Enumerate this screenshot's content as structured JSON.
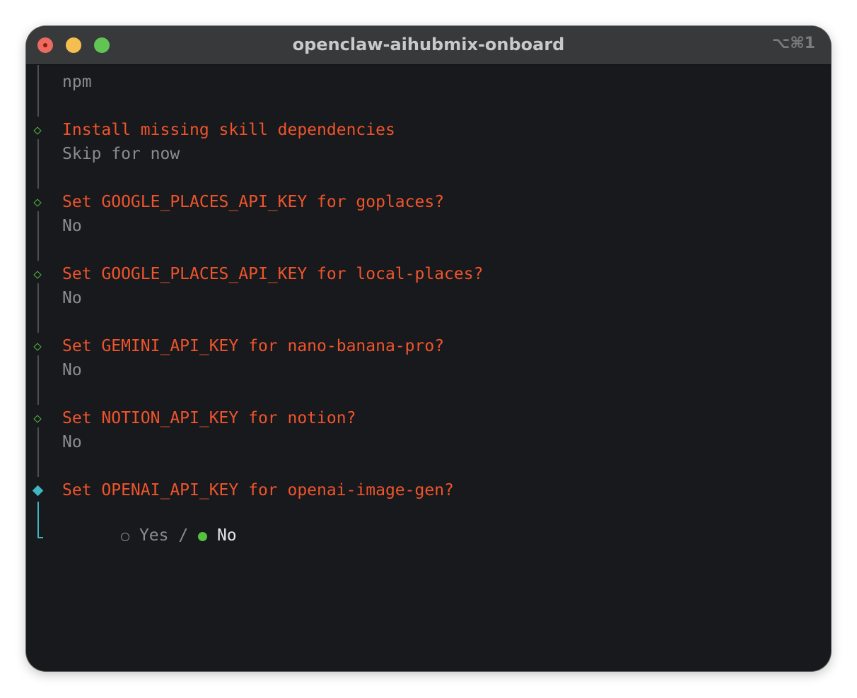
{
  "window": {
    "title": "openclaw-aihubmix-onboard",
    "shortcut": "⌥⌘1"
  },
  "terminal": {
    "top_answer": "npm",
    "steps": [
      {
        "question": "Install missing skill dependencies",
        "answer": "Skip for now"
      },
      {
        "question": "Set GOOGLE_PLACES_API_KEY for goplaces?",
        "answer": "No"
      },
      {
        "question": "Set GOOGLE_PLACES_API_KEY for local-places?",
        "answer": "No"
      },
      {
        "question": "Set GEMINI_API_KEY for nano-banana-pro?",
        "answer": "No"
      },
      {
        "question": "Set NOTION_API_KEY for notion?",
        "answer": "No"
      }
    ],
    "active_prompt": {
      "question": "Set OPENAI_API_KEY for openai-image-gen?",
      "option_yes": "Yes",
      "separator": "/",
      "option_no": "No",
      "selected": "No"
    }
  },
  "colors": {
    "question": "#f0542b",
    "answer": "#8a8c90",
    "done_marker": "#55b93f",
    "active_marker": "#3fb6c2",
    "selected_dot": "#55c13f"
  }
}
